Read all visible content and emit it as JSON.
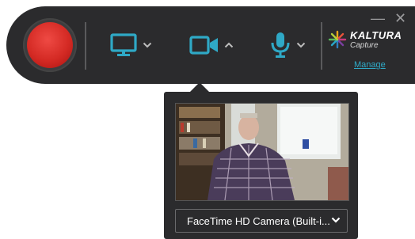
{
  "window": {
    "minimize_label": "—",
    "close_label": "✕"
  },
  "toolbar": {
    "record_button": "record",
    "screen_icon": "monitor-icon",
    "camera_icon": "video-camera-icon",
    "mic_icon": "microphone-icon",
    "accent_color": "#2fa9c6",
    "record_color": "#d42a24"
  },
  "brand": {
    "name": "KALTURA",
    "product": "Capture",
    "manage_link": "Manage"
  },
  "camera_panel": {
    "device_selected": "FaceTime HD Camera (Built-i..."
  }
}
